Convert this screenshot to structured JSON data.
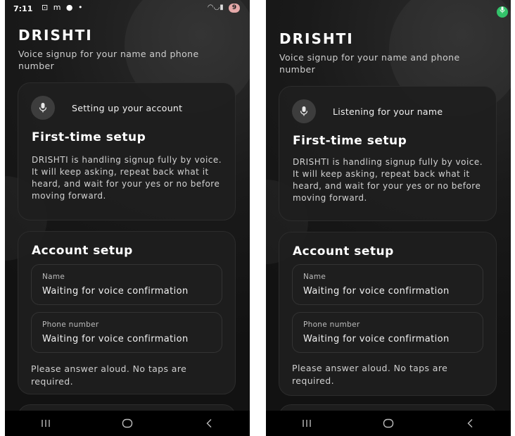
{
  "screens": [
    {
      "status_bar": {
        "time": "7:11",
        "notification_icons": "⊡ m ● •",
        "battery": "9"
      },
      "app_title": "DRISHTI",
      "app_subtitle": "Voice signup for your name and phone number",
      "status_card": {
        "mic_icon": "microphone-icon",
        "status_label": "Setting up your account",
        "heading": "First-time setup",
        "body": "DRISHTI is handling signup fully by voice. It will keep asking, repeat back what it heard, and wait for your yes or no before moving forward."
      },
      "account_card": {
        "heading": "Account setup",
        "fields": [
          {
            "label": "Name",
            "value": "Waiting for voice confirmation"
          },
          {
            "label": "Phone number",
            "value": "Waiting for voice confirmation"
          }
        ],
        "hint": "Please answer aloud. No taps are required."
      },
      "nav": [
        "recent-apps-icon",
        "home-icon",
        "back-icon"
      ]
    },
    {
      "mic_active_indicator": "microphone-icon",
      "app_title": "DRISHTI",
      "app_subtitle": "Voice signup for your name and phone number",
      "status_card": {
        "mic_icon": "microphone-icon",
        "status_label": "Listening for your name",
        "heading": "First-time setup",
        "body": "DRISHTI is handling signup fully by voice. It will keep asking, repeat back what it heard, and wait for your yes or no before moving forward."
      },
      "account_card": {
        "heading": "Account setup",
        "fields": [
          {
            "label": "Name",
            "value": "Waiting for voice confirmation"
          },
          {
            "label": "Phone number",
            "value": "Waiting for voice confirmation"
          }
        ],
        "hint": "Please answer aloud. No taps are required."
      },
      "nav": [
        "recent-apps-icon",
        "home-icon",
        "back-icon"
      ]
    }
  ]
}
